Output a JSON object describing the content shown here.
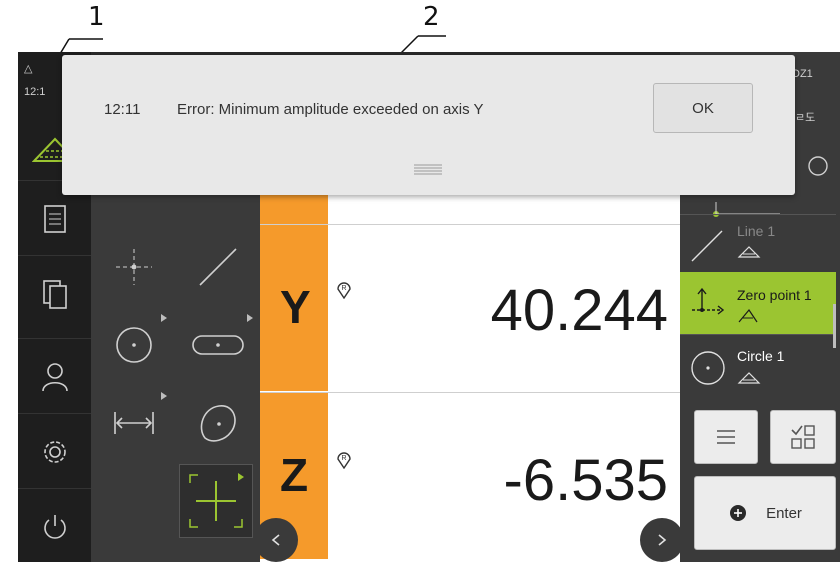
{
  "callouts": [
    "1",
    "2"
  ],
  "status": {
    "time": "12:1",
    "top_right": "DZ1",
    "top_right_2": "ㄹ도"
  },
  "dialog": {
    "time": "12:11",
    "message": "Error: Minimum amplitude exceeded on axis Y",
    "ok_label": "OK"
  },
  "axes": [
    {
      "letter": "Y",
      "value": "40.244"
    },
    {
      "letter": "Z",
      "value": "-6.535"
    }
  ],
  "features": [
    {
      "label": "Line 1"
    },
    {
      "label": "Zero point 1"
    },
    {
      "label": "Circle 1"
    }
  ],
  "enter_label": "Enter",
  "colors": {
    "accent_green": "#9bc531",
    "axis_orange": "#f59a2b",
    "palette_bg": "#3a3a3a"
  },
  "icons": [
    "measure-icon",
    "document-icon",
    "files-icon",
    "user-icon",
    "settings-icon",
    "power-icon",
    "menu-icon",
    "quickaccess-icon",
    "plus-icon",
    "chevron-left-icon",
    "chevron-right-icon"
  ]
}
